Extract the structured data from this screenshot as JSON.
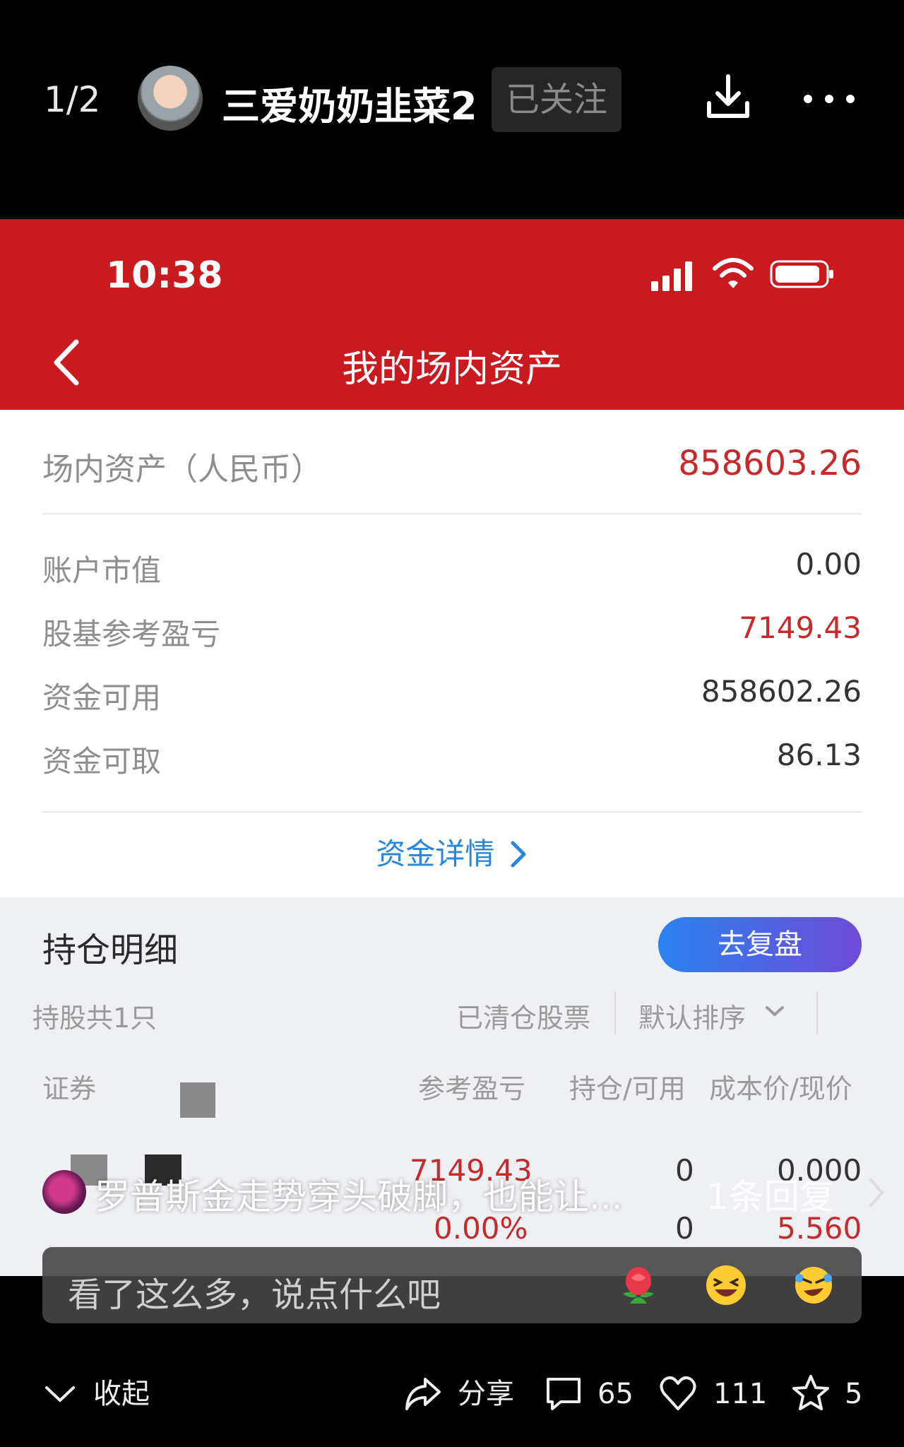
{
  "viewer": {
    "counter": "1/2",
    "author": "三爱奶奶韭菜2",
    "follow_label": "已关注"
  },
  "app": {
    "status_time": "10:38",
    "title": "我的场内资产",
    "brand_color": "#c91a20",
    "assets_label": "场内资产（人民币）",
    "assets_value": "858603.26",
    "rows": [
      {
        "label": "账户市值",
        "value": "0.00"
      },
      {
        "label": "股基参考盈亏",
        "value": "7149.43"
      },
      {
        "label": "资金可用",
        "value": "858602.26"
      },
      {
        "label": "资金可取",
        "value": "86.13"
      }
    ],
    "details_link": "资金详情",
    "holdings_title": "持仓明细",
    "review_button": "去复盘",
    "tabs": {
      "count": "持股共1只",
      "cleared": "已清仓股票",
      "sort": "默认排序"
    },
    "columns": [
      "证券",
      "参考盈亏",
      "持仓/可用",
      "成本价/现价"
    ],
    "holding": {
      "pnl": "7149.43",
      "pnl_pct": "0.00%",
      "position": "0",
      "available": "0",
      "cost": "0.000",
      "price": "5.560"
    }
  },
  "comments": {
    "preview_text": "罗普斯金走势穿头破脚，也能让...",
    "reply_count": "1条回复",
    "input_placeholder": "看了这么多，说点什么吧"
  },
  "bottom": {
    "collapse": "收起",
    "share": "分享",
    "comments": "65",
    "likes": "111",
    "favorites": "5"
  }
}
